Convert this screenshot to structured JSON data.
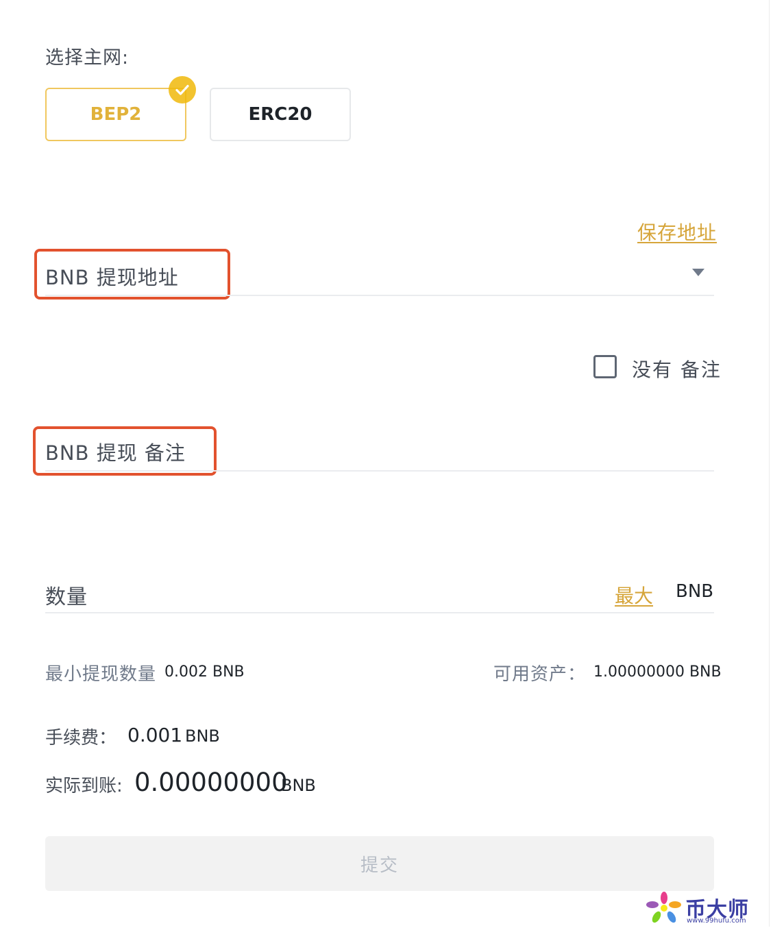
{
  "network": {
    "label": "选择主网:",
    "options": [
      {
        "label": "BEP2",
        "selected": true
      },
      {
        "label": "ERC20",
        "selected": false
      }
    ],
    "accent_color": "#f0b90b"
  },
  "address": {
    "save_link": "保存地址",
    "label": "BNB 提现地址"
  },
  "memo": {
    "no_memo_label": "没有 备注",
    "no_memo_checked": false,
    "label": "BNB 提现 备注"
  },
  "amount": {
    "label": "数量",
    "max_link": "最大",
    "unit": "BNB"
  },
  "limits": {
    "min_label": "最小提现数量",
    "min_value": "0.002 BNB",
    "available_label": "可用资产：",
    "available_value": "1.00000000 BNB"
  },
  "fee": {
    "label": "手续费：",
    "value": "0.001",
    "unit": "BNB"
  },
  "receive": {
    "label": "实际到账:",
    "value": "0.00000000",
    "unit": "BNB"
  },
  "submit": {
    "label": "提交"
  },
  "watermark": {
    "text": "币大师",
    "url": "www.99hufu.com"
  },
  "colors": {
    "highlight_box": "#e2522e",
    "link": "#d6a53a"
  }
}
